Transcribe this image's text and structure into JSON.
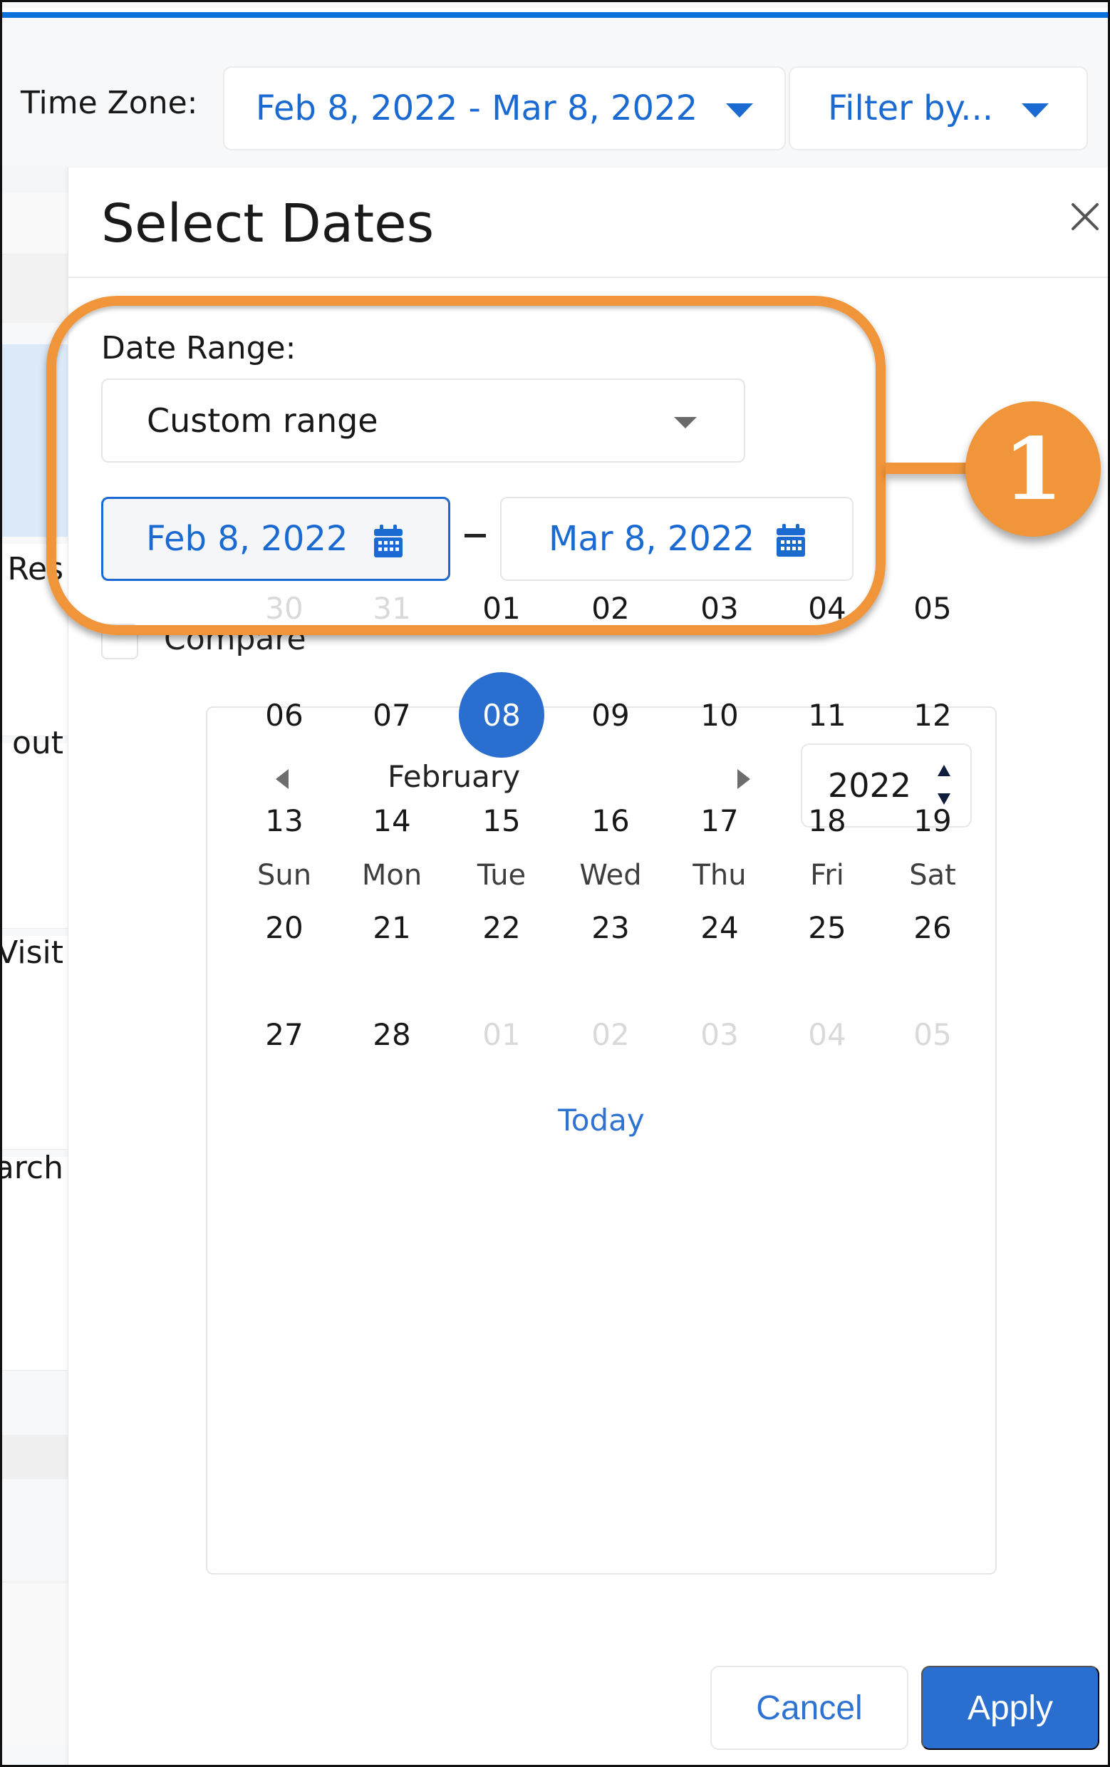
{
  "toolbar": {
    "time_zone_label": "Time Zone:",
    "date_range_value": "Feb 8, 2022 - Mar 8, 2022",
    "filter_label": "Filter by..."
  },
  "background_list": {
    "items": [
      {
        "text": "a Res"
      },
      {
        "text": "out"
      },
      {
        "text": "Visit"
      },
      {
        "text": "arch"
      }
    ]
  },
  "dialog": {
    "title": "Select Dates",
    "close_icon": "close-icon",
    "date_range_label": "Date Range:",
    "date_range_selected": "Custom range",
    "start_date": "Feb 8, 2022",
    "end_date": "Mar 8, 2022",
    "compare_label": "Compare",
    "compare_checked": false,
    "calendar": {
      "month": "February",
      "year": "2022",
      "weekdays": [
        "Sun",
        "Mon",
        "Tue",
        "Wed",
        "Thu",
        "Fri",
        "Sat"
      ],
      "weeks": [
        [
          {
            "d": "30",
            "muted": true
          },
          {
            "d": "31",
            "muted": true
          },
          {
            "d": "01"
          },
          {
            "d": "02"
          },
          {
            "d": "03"
          },
          {
            "d": "04"
          },
          {
            "d": "05"
          }
        ],
        [
          {
            "d": "06"
          },
          {
            "d": "07"
          },
          {
            "d": "08",
            "selected": true
          },
          {
            "d": "09"
          },
          {
            "d": "10"
          },
          {
            "d": "11"
          },
          {
            "d": "12"
          }
        ],
        [
          {
            "d": "13"
          },
          {
            "d": "14"
          },
          {
            "d": "15"
          },
          {
            "d": "16"
          },
          {
            "d": "17"
          },
          {
            "d": "18"
          },
          {
            "d": "19"
          }
        ],
        [
          {
            "d": "20"
          },
          {
            "d": "21"
          },
          {
            "d": "22"
          },
          {
            "d": "23"
          },
          {
            "d": "24"
          },
          {
            "d": "25"
          },
          {
            "d": "26"
          }
        ],
        [
          {
            "d": "27"
          },
          {
            "d": "28"
          },
          {
            "d": "01",
            "muted": true
          },
          {
            "d": "02",
            "muted": true
          },
          {
            "d": "03",
            "muted": true
          },
          {
            "d": "04",
            "muted": true
          },
          {
            "d": "05",
            "muted": true
          }
        ]
      ],
      "today_label": "Today"
    },
    "cancel_label": "Cancel",
    "apply_label": "Apply"
  },
  "annotation": {
    "badge_number": "1"
  },
  "colors": {
    "accent": "#2a6fcf",
    "link": "#1b6ad1",
    "callout": "#f0953a"
  }
}
